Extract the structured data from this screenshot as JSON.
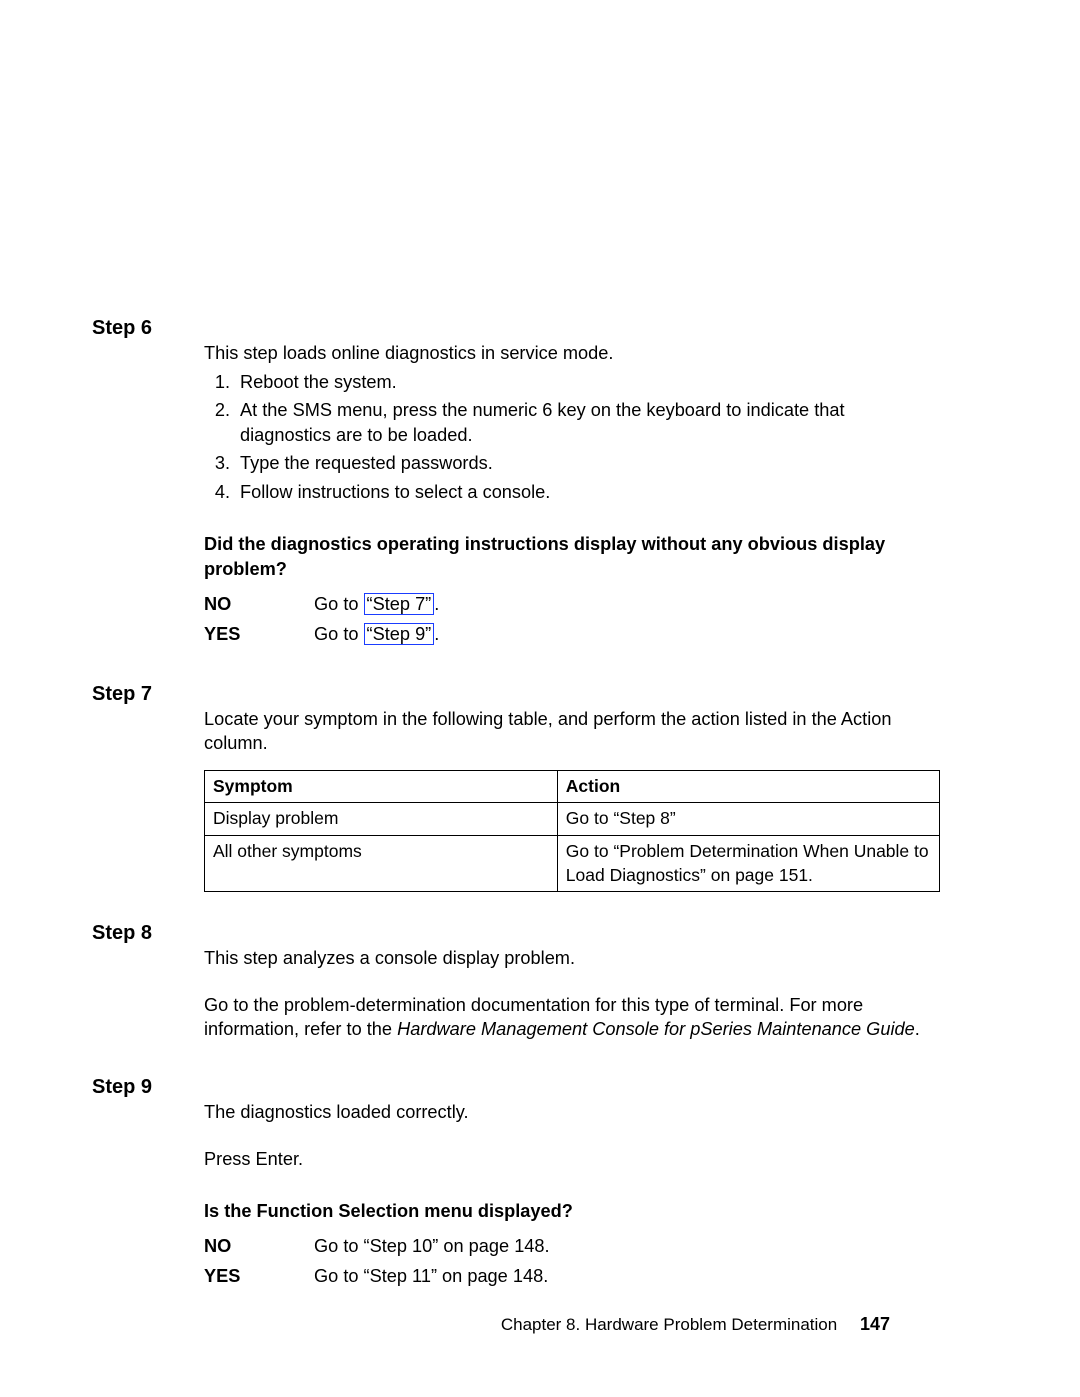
{
  "step6": {
    "heading": "Step 6",
    "intro": "This step loads online diagnostics in service mode.",
    "items": [
      "Reboot the system.",
      "At the SMS menu, press the numeric 6 key on the keyboard to indicate that diagnostics are to be loaded.",
      "Type the requested passwords.",
      "Follow instructions to select a console."
    ],
    "question": "Did the diagnostics operating instructions display without any obvious display problem?",
    "no_prefix": "Go to ",
    "no_link": "“Step 7”",
    "no_suffix": ".",
    "yes_prefix": "Go to ",
    "yes_link": "“Step 9”",
    "yes_suffix": ".",
    "no_label": "NO",
    "yes_label": "YES"
  },
  "step7": {
    "heading": "Step 7",
    "intro": "Locate your symptom in the following table, and perform the action listed in the Action column.",
    "th1": "Symptom",
    "th2": "Action",
    "rows": [
      {
        "s": "Display problem",
        "a": "Go to “Step 8”"
      },
      {
        "s": "All other symptoms",
        "a": "Go to “Problem Determination When Unable to Load Diagnostics” on page 151."
      }
    ]
  },
  "step8": {
    "heading": "Step 8",
    "p1": "This step analyzes a console display problem.",
    "p2a": "Go to the problem-determination documentation for this type of terminal. For more information, refer to the ",
    "p2b": "Hardware Management Console for pSeries Maintenance Guide",
    "p2c": "."
  },
  "step9": {
    "heading": "Step 9",
    "p1": "The diagnostics loaded correctly.",
    "p2": "Press Enter.",
    "question": "Is the Function Selection menu displayed?",
    "no_label": "NO",
    "no_text": "Go to “Step 10” on page 148.",
    "yes_label": "YES",
    "yes_text": "Go to “Step 11” on page 148."
  },
  "footer": {
    "chapter": "Chapter 8. Hardware Problem Determination",
    "page": "147"
  }
}
